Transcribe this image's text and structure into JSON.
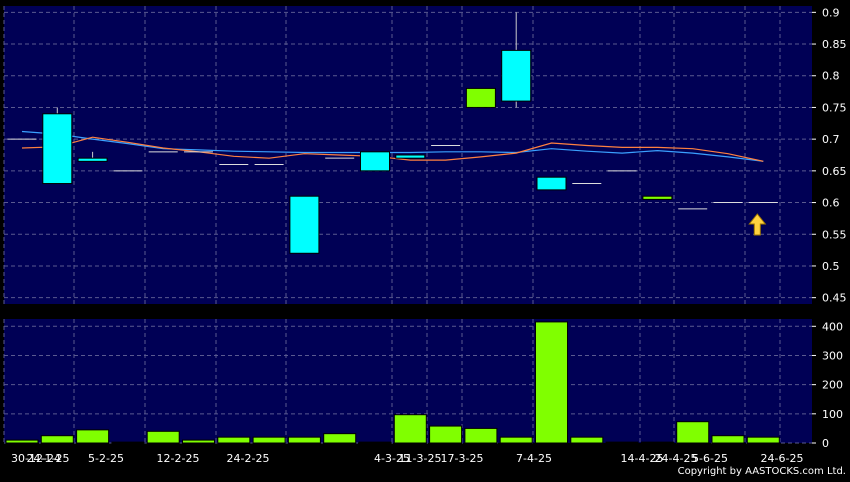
{
  "chart_data": {
    "type": "candlestick",
    "x_labels": [
      "30-12-24",
      "24-1-25",
      "5-2-25",
      "12-2-25",
      "24-2-25",
      "4-3-25",
      "11-3-25",
      "17-3-25",
      "7-4-25",
      "14-4-25",
      "24-4-25",
      "5-6-25",
      "24-6-25"
    ],
    "price_axis": {
      "ticks": [
        0.45,
        0.5,
        0.55,
        0.6,
        0.65,
        0.7,
        0.75,
        0.8,
        0.85,
        0.9
      ],
      "range": [
        0.44,
        0.91
      ]
    },
    "volume_axis": {
      "ticks": [
        0,
        100,
        200,
        300,
        400
      ],
      "range": [
        0,
        425
      ]
    },
    "candles": [
      {
        "open": 0.7,
        "high": 0.7,
        "low": 0.7,
        "close": 0.7
      },
      {
        "open": 0.63,
        "high": 0.75,
        "low": 0.63,
        "close": 0.74
      },
      {
        "open": 0.665,
        "high": 0.68,
        "low": 0.665,
        "close": 0.67
      },
      {
        "open": 0.65,
        "high": 0.65,
        "low": 0.65,
        "close": 0.65
      },
      {
        "open": 0.68,
        "high": 0.68,
        "low": 0.68,
        "close": 0.68
      },
      {
        "open": 0.68,
        "high": 0.68,
        "low": 0.68,
        "close": 0.68
      },
      {
        "open": 0.66,
        "high": 0.66,
        "low": 0.66,
        "close": 0.66
      },
      {
        "open": 0.66,
        "high": 0.66,
        "low": 0.66,
        "close": 0.66
      },
      {
        "open": 0.52,
        "high": 0.61,
        "low": 0.52,
        "close": 0.61
      },
      {
        "open": 0.67,
        "high": 0.67,
        "low": 0.67,
        "close": 0.67
      },
      {
        "open": 0.65,
        "high": 0.68,
        "low": 0.65,
        "close": 0.68
      },
      {
        "open": 0.67,
        "high": 0.675,
        "low": 0.67,
        "close": 0.675
      },
      {
        "open": 0.69,
        "high": 0.69,
        "low": 0.69,
        "close": 0.69
      },
      {
        "open": 0.78,
        "high": 0.78,
        "low": 0.75,
        "close": 0.75
      },
      {
        "open": 0.76,
        "high": 0.9,
        "low": 0.75,
        "close": 0.84
      },
      {
        "open": 0.62,
        "high": 0.64,
        "low": 0.62,
        "close": 0.64
      },
      {
        "open": 0.63,
        "high": 0.63,
        "low": 0.63,
        "close": 0.63
      },
      {
        "open": 0.65,
        "high": 0.65,
        "low": 0.65,
        "close": 0.65
      },
      {
        "open": 0.61,
        "high": 0.61,
        "low": 0.605,
        "close": 0.605
      },
      {
        "open": 0.59,
        "high": 0.59,
        "low": 0.59,
        "close": 0.59
      },
      {
        "open": 0.6,
        "high": 0.6,
        "low": 0.6,
        "close": 0.6
      },
      {
        "open": 0.6,
        "high": 0.6,
        "low": 0.6,
        "close": 0.6
      }
    ],
    "volume": [
      10,
      25,
      45,
      3,
      40,
      10,
      20,
      20,
      20,
      32,
      3,
      97,
      58,
      50,
      20,
      415,
      20,
      3,
      3,
      73,
      25,
      20
    ],
    "volume_colors": [
      "green",
      "green",
      "green",
      "green",
      "green",
      "green",
      "green",
      "green",
      "green",
      "green",
      "green",
      "green",
      "green",
      "green",
      "green",
      "green",
      "green",
      "green",
      "green",
      "green",
      "green",
      "green"
    ],
    "ma_series": [
      {
        "color": "#3aa0ff",
        "values": [
          0.712,
          0.708,
          0.7,
          0.693,
          0.685,
          0.683,
          0.681,
          0.68,
          0.679,
          0.679,
          0.679,
          0.679,
          0.68,
          0.68,
          0.679,
          0.685,
          0.681,
          0.678,
          0.682,
          0.678,
          0.672,
          0.665
        ]
      },
      {
        "color": "#ff8040",
        "values": [
          0.686,
          0.688,
          0.703,
          0.695,
          0.686,
          0.68,
          0.673,
          0.67,
          0.677,
          0.675,
          0.673,
          0.667,
          0.667,
          0.672,
          0.678,
          0.694,
          0.69,
          0.687,
          0.687,
          0.685,
          0.677,
          0.665
        ]
      }
    ],
    "colors": {
      "up": "#00ffff",
      "down": "#80ff00",
      "plot_bg": "#000055",
      "grid": "#5a5a90"
    }
  },
  "copyright": "Copyright by AASTOCKS.com Ltd."
}
